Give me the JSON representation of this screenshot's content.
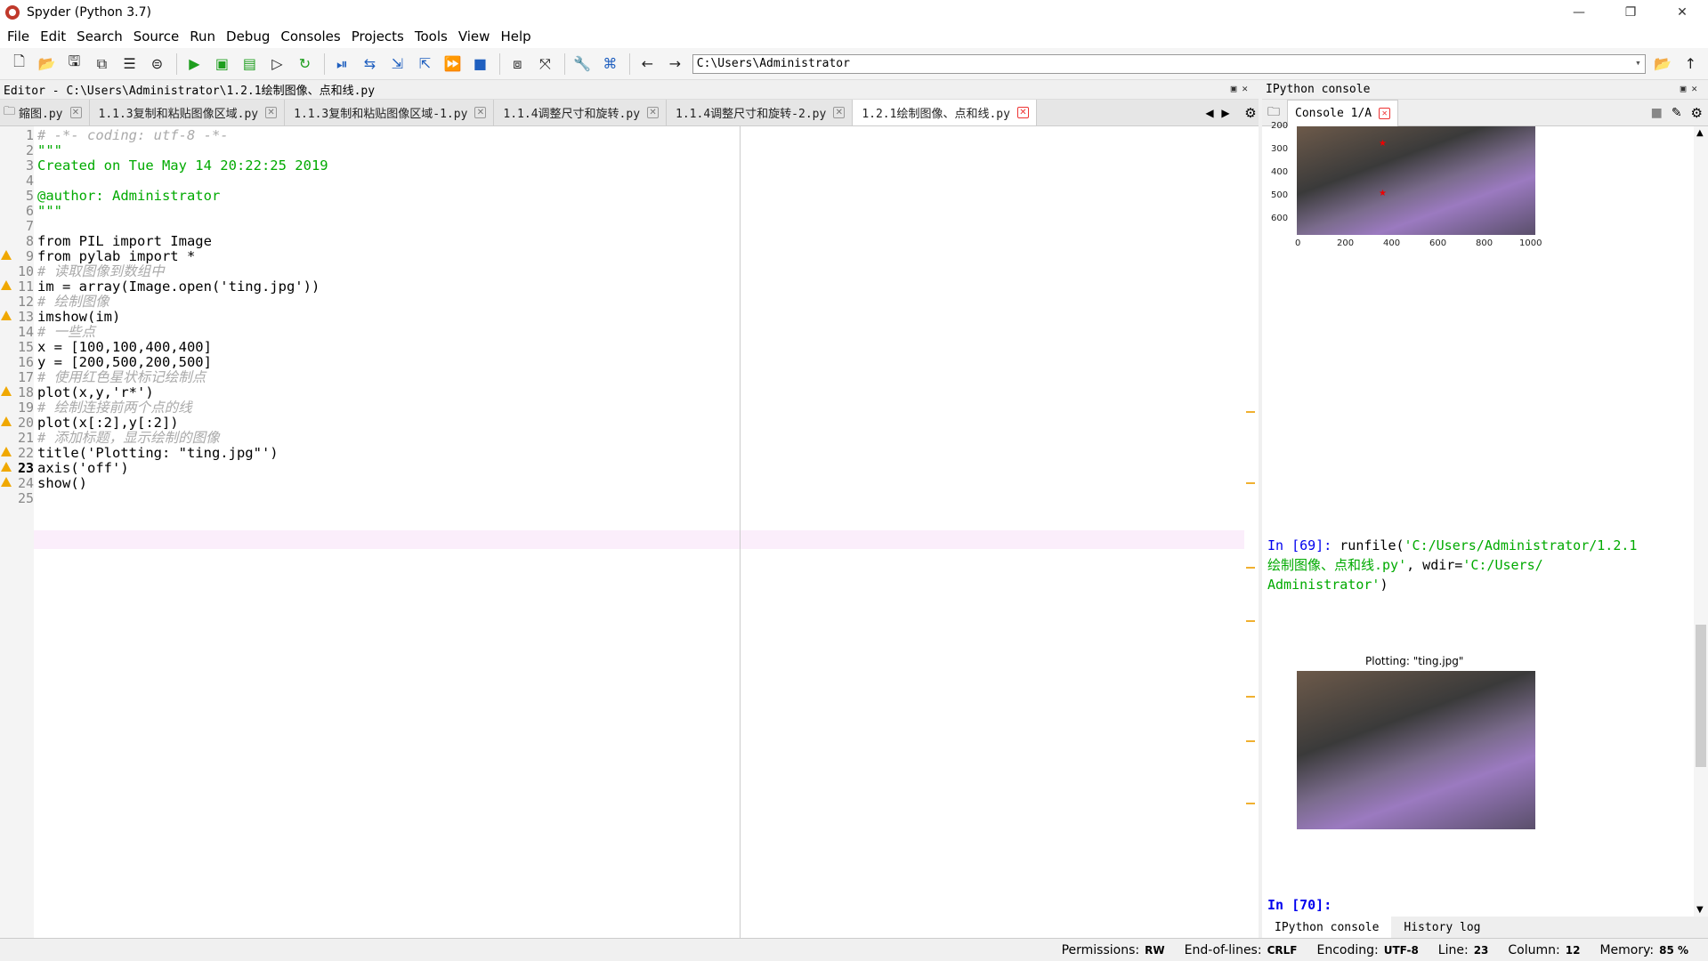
{
  "window": {
    "title": "Spyder (Python 3.7)",
    "minimize": "—",
    "maximize": "❐",
    "close": "✕"
  },
  "menu": [
    "File",
    "Edit",
    "Search",
    "Source",
    "Run",
    "Debug",
    "Consoles",
    "Projects",
    "Tools",
    "View",
    "Help"
  ],
  "toolbar": {
    "path": "C:\\Users\\Administrator"
  },
  "editor": {
    "header": "Editor - C:\\Users\\Administrator\\1.2.1绘制图像、点和线.py",
    "tabs": [
      {
        "label": "鏥图.py"
      },
      {
        "label": "1.1.3复制和粘贴图像区域.py"
      },
      {
        "label": "1.1.3复制和粘贴图像区域-1.py"
      },
      {
        "label": "1.1.4调整尺寸和旋转.py"
      },
      {
        "label": "1.1.4调整尺寸和旋转-2.py"
      },
      {
        "label": "1.2.1绘制图像、点和线.py",
        "active": true
      }
    ],
    "lines": [
      {
        "n": "1",
        "t": "# -*- coding: utf-8 -*-"
      },
      {
        "n": "2",
        "t": "\"\"\""
      },
      {
        "n": "3",
        "t": "Created on Tue May 14 20:22:25 2019"
      },
      {
        "n": "4",
        "t": ""
      },
      {
        "n": "5",
        "t": "@author: Administrator"
      },
      {
        "n": "6",
        "t": "\"\"\""
      },
      {
        "n": "7",
        "t": ""
      },
      {
        "n": "8",
        "t": "from PIL import Image"
      },
      {
        "n": "9",
        "t": "from pylab import *"
      },
      {
        "n": "10",
        "t": "# 读取图像到数组中"
      },
      {
        "n": "11",
        "t": "im = array(Image.open('ting.jpg'))"
      },
      {
        "n": "12",
        "t": "# 绘制图像"
      },
      {
        "n": "13",
        "t": "imshow(im)"
      },
      {
        "n": "14",
        "t": "# 一些点"
      },
      {
        "n": "15",
        "t": "x = [100,100,400,400]"
      },
      {
        "n": "16",
        "t": "y = [200,500,200,500]"
      },
      {
        "n": "17",
        "t": "# 使用红色星状标记绘制点"
      },
      {
        "n": "18",
        "t": "plot(x,y,'r*')"
      },
      {
        "n": "19",
        "t": "# 绘制连接前两个点的线"
      },
      {
        "n": "20",
        "t": "plot(x[:2],y[:2])"
      },
      {
        "n": "21",
        "t": "# 添加标题，显示绘制的图像"
      },
      {
        "n": "22",
        "t": "title('Plotting: \"ting.jpg\"')"
      },
      {
        "n": "23",
        "t": "axis('off')"
      },
      {
        "n": "24",
        "t": "show()"
      },
      {
        "n": "25",
        "t": ""
      }
    ]
  },
  "console": {
    "header": "IPython console",
    "tab": "Console 1/A",
    "plot1": {
      "yticks": [
        "200",
        "300",
        "400",
        "500",
        "600"
      ],
      "xticks": [
        "0",
        "200",
        "400",
        "600",
        "800",
        "1000"
      ]
    },
    "in69_prompt": "In [69]:",
    "in69_cmd1": " runfile(",
    "in69_str1": "'C:/Users/Administrator/1.2.1",
    "in69_str2": "绘制图像、点和线.py'",
    "in69_mid": ", wdir=",
    "in69_str3": "'C:/Users/",
    "in69_str4": "Administrator'",
    "in69_end": ")",
    "plot2_title": "Plotting: \"ting.jpg\"",
    "in70_prompt": "In [70]:",
    "bottom_tabs": [
      "IPython console",
      "History log"
    ]
  },
  "status": {
    "permissions_label": "Permissions:",
    "permissions": "RW",
    "eol_label": "End-of-lines:",
    "eol": "CRLF",
    "encoding_label": "Encoding:",
    "encoding": "UTF-8",
    "line_label": "Line:",
    "line": "23",
    "column_label": "Column:",
    "column": "12",
    "memory_label": "Memory:",
    "memory": "85 %"
  }
}
